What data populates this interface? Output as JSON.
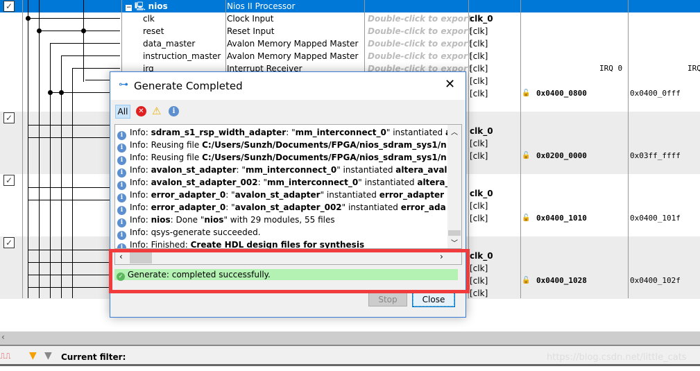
{
  "rows": {
    "nios": {
      "name": "nios",
      "desc": "Nios II Processor"
    },
    "ports": [
      {
        "name": "clk",
        "desc": "Clock Input",
        "export": "Double-click to export",
        "clock": "clk_0"
      },
      {
        "name": "reset",
        "desc": "Reset Input",
        "export": "Double-click to export",
        "clock": "[clk]"
      },
      {
        "name": "data_master",
        "desc": "Avalon Memory Mapped Master",
        "export": "Double-click to export",
        "clock": "[clk]"
      },
      {
        "name": "instruction_master",
        "desc": "Avalon Memory Mapped Master",
        "export": "Double-click to export",
        "clock": "[clk]"
      },
      {
        "name": "irq",
        "desc": "Interrupt Receiver",
        "export": "Double-click to export",
        "clock": "[clk]",
        "irq": "IRQ 0",
        "irq2": "IRQ"
      }
    ],
    "extra_clocks": [
      "[clk]",
      "[clk]"
    ],
    "nios_base": "0x0400_0800",
    "nios_end": "0x0400_0fff",
    "groups": [
      {
        "clocks": [
          "clk_0",
          "[clk]",
          "[clk]"
        ],
        "base": "0x0200_0000",
        "end": "0x03ff_ffff"
      },
      {
        "clocks": [
          "clk_0",
          "[clk]",
          "[clk]"
        ],
        "base": "0x0400_1010",
        "end": "0x0400_101f"
      },
      {
        "clocks": [
          "clk_0",
          "[clk]",
          "[clk]",
          "[clk]"
        ],
        "base": "0x0400_1028",
        "end": "0x0400_102f"
      }
    ]
  },
  "dialog": {
    "title": "Generate Completed",
    "filter_all": "All",
    "log": [
      [
        [
          "Info: ",
          0
        ],
        [
          "sdram_s1_rsp_width_adapter",
          1
        ],
        [
          ": \"",
          0
        ],
        [
          "mm_interconnect_0",
          1
        ],
        [
          "\" instantiated ",
          0
        ],
        [
          "a",
          1
        ]
      ],
      [
        [
          "Info: Reusing file ",
          0
        ],
        [
          "C:/Users/Sunzh/Documents/FPGA/nios_sdram_sys1/n",
          1
        ]
      ],
      [
        [
          "Info: Reusing file ",
          0
        ],
        [
          "C:/Users/Sunzh/Documents/FPGA/nios_sdram_sys1/n",
          1
        ]
      ],
      [
        [
          "Info: ",
          0
        ],
        [
          "avalon_st_adapter",
          1
        ],
        [
          ": \"",
          0
        ],
        [
          "mm_interconnect_0",
          1
        ],
        [
          "\" instantiated ",
          0
        ],
        [
          "altera_avalo",
          1
        ]
      ],
      [
        [
          "Info: ",
          0
        ],
        [
          "avalon_st_adapter_002",
          1
        ],
        [
          ": \"",
          0
        ],
        [
          "mm_interconnect_0",
          1
        ],
        [
          "\" instantiated ",
          0
        ],
        [
          "altera_",
          1
        ]
      ],
      [
        [
          "Info: ",
          0
        ],
        [
          "error_adapter_0",
          1
        ],
        [
          ": \"",
          0
        ],
        [
          "avalon_st_adapter",
          1
        ],
        [
          "\" instantiated ",
          0
        ],
        [
          "error_adapter",
          1
        ]
      ],
      [
        [
          "Info: ",
          0
        ],
        [
          "error_adapter_0",
          1
        ],
        [
          ": \"",
          0
        ],
        [
          "avalon_st_adapter_002",
          1
        ],
        [
          "\" instantiated ",
          0
        ],
        [
          "error_ada",
          1
        ]
      ],
      [
        [
          "Info: ",
          0
        ],
        [
          "nios",
          1
        ],
        [
          ": Done \"",
          0
        ],
        [
          "nios",
          1
        ],
        [
          "\" with 29 modules, 55 files",
          0
        ]
      ],
      [
        [
          "Info: qsys-generate succeeded.",
          0
        ]
      ],
      [
        [
          "Info: Finished: ",
          0
        ],
        [
          "Create HDL design files for synthesis",
          1
        ]
      ]
    ],
    "status": "Generate: completed successfully.",
    "stop": "Stop",
    "close": "Close"
  },
  "statusbar": {
    "filter_label": "Current filter:",
    "watermark": "https://blog.csdn.net/little_cats"
  },
  "colors": {
    "selection": "#0078d7",
    "success": "#b3f2b3",
    "highlight": "#f03c3c"
  }
}
